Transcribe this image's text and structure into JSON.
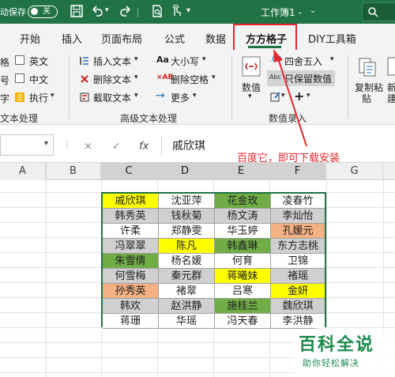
{
  "titlebar": {
    "autosave_label": "动保存",
    "autosave_state": "关",
    "workbook_title": "工作簿1 -"
  },
  "tabs": [
    {
      "label": "开始",
      "active": false
    },
    {
      "label": "插入",
      "active": false
    },
    {
      "label": "页面布局",
      "active": false
    },
    {
      "label": "公式",
      "active": false
    },
    {
      "label": "数据",
      "active": false
    },
    {
      "label": "方方格子",
      "active": true
    },
    {
      "label": "DIY工具箱",
      "active": false
    }
  ],
  "ribbon": {
    "left_items": [
      "格",
      "号",
      "字"
    ],
    "col2_items": [
      "英文",
      "中文",
      "执行"
    ],
    "col3_items": [
      "插入文本",
      "删除文本",
      "截取文本"
    ],
    "col4_items": [
      "大小写",
      "删除空格",
      "更多"
    ],
    "group_text_processing": "文本处理",
    "group_advanced_text": "高级文本处理",
    "numeric_label": "数值",
    "round_label": "四舍五入",
    "keep_value_label": "只保留数值",
    "group_data_entry": "数值录入",
    "copy_paste_label": "复制粘",
    "copy_paste_label2": "贴",
    "new_label": "新",
    "new_label2": "建"
  },
  "formula_bar": {
    "cancel": "×",
    "confirm": "✓",
    "fx": "fx",
    "value": "戚欣琪",
    "annotation": "百度它，即可下载安装"
  },
  "columns": [
    "A",
    "B",
    "C",
    "D",
    "E",
    "F",
    "G"
  ],
  "table": {
    "rows": [
      [
        {
          "t": "戚欣琪",
          "bg": "#ffff00"
        },
        {
          "t": "沈亚萍",
          "bg": "#ffffff"
        },
        {
          "t": "花金玫",
          "bg": "#70ad47"
        },
        {
          "t": "凌春竹",
          "bg": "#ffffff"
        }
      ],
      [
        {
          "t": "韩秀英",
          "bg": "#d0d0d0"
        },
        {
          "t": "钱秋菊",
          "bg": "#d0d0d0"
        },
        {
          "t": "杨文涛",
          "bg": "#d0d0d0"
        },
        {
          "t": "李灿怡",
          "bg": "#d0d0d0"
        }
      ],
      [
        {
          "t": "许柔",
          "bg": "#ffffff"
        },
        {
          "t": "郑静雯",
          "bg": "#ffffff"
        },
        {
          "t": "华玉婷",
          "bg": "#ffffff"
        },
        {
          "t": "孔媛元",
          "bg": "#f4b183"
        }
      ],
      [
        {
          "t": "冯翠翠",
          "bg": "#d0d0d0"
        },
        {
          "t": "陈凡",
          "bg": "#ffff00"
        },
        {
          "t": "韩鑫琳",
          "bg": "#70ad47"
        },
        {
          "t": "东方志桃",
          "bg": "#d0d0d0"
        }
      ],
      [
        {
          "t": "朱雪倩",
          "bg": "#70ad47"
        },
        {
          "t": "杨名媛",
          "bg": "#ffffff"
        },
        {
          "t": "何育",
          "bg": "#ffffff"
        },
        {
          "t": "卫锦",
          "bg": "#ffffff"
        }
      ],
      [
        {
          "t": "何雪梅",
          "bg": "#d0d0d0"
        },
        {
          "t": "秦元群",
          "bg": "#d0d0d0"
        },
        {
          "t": "蒋曦妹",
          "bg": "#ffff00"
        },
        {
          "t": "褚瑶",
          "bg": "#d0d0d0"
        }
      ],
      [
        {
          "t": "孙秀英",
          "bg": "#f4b183"
        },
        {
          "t": "褚翠",
          "bg": "#ffffff"
        },
        {
          "t": "吕寒",
          "bg": "#ffffff"
        },
        {
          "t": "金妍",
          "bg": "#ffff00"
        }
      ],
      [
        {
          "t": "韩欢",
          "bg": "#d0d0d0"
        },
        {
          "t": "赵洪静",
          "bg": "#d0d0d0"
        },
        {
          "t": "施桂兰",
          "bg": "#70ad47"
        },
        {
          "t": "魏欣琪",
          "bg": "#d0d0d0"
        }
      ],
      [
        {
          "t": "蒋珊",
          "bg": "#ffffff"
        },
        {
          "t": "华瑶",
          "bg": "#ffffff"
        },
        {
          "t": "冯天春",
          "bg": "#ffffff"
        },
        {
          "t": "李洪静",
          "bg": "#ffffff"
        }
      ]
    ]
  },
  "watermark": {
    "title": "百科全说",
    "subtitle": "助你轻松解决"
  },
  "colors": {
    "excel_green": "#217346",
    "annotation_red": "#e8262c"
  }
}
